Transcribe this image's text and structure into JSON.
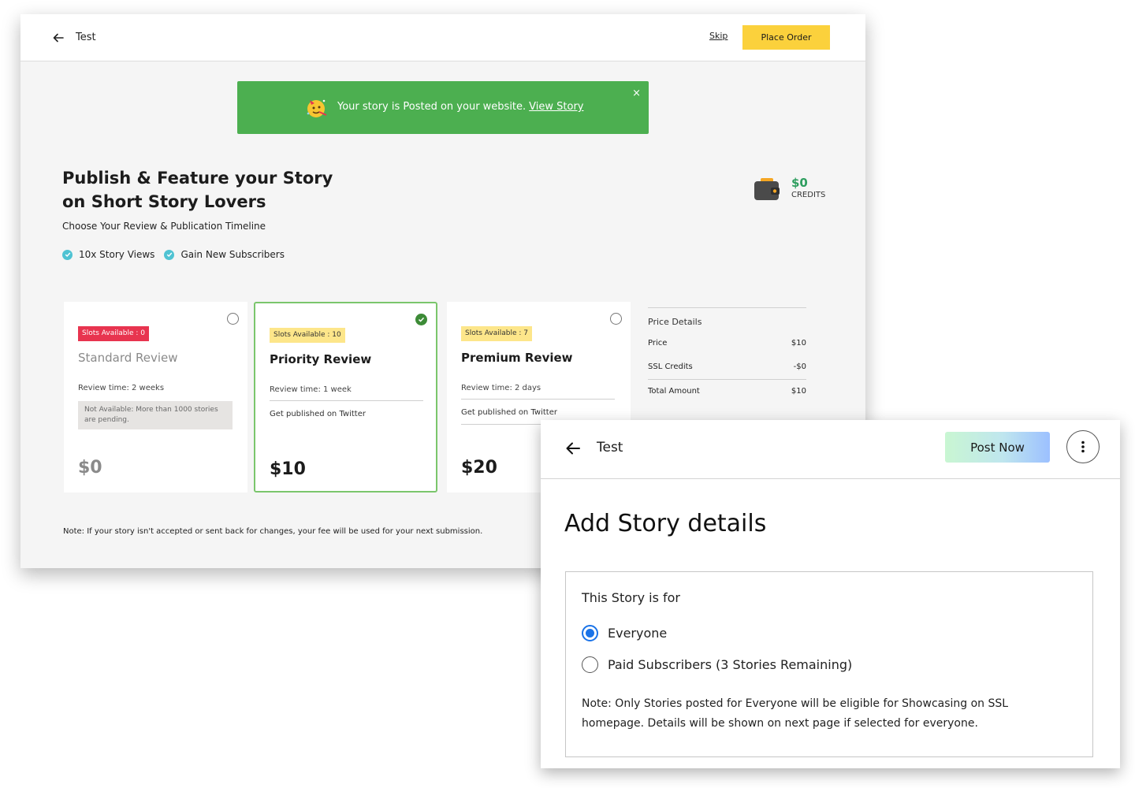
{
  "publish_window": {
    "header": {
      "title": "Test",
      "skip_label": "Skip",
      "place_order_label": "Place Order"
    },
    "toast": {
      "message": "Your story is Posted on your website.",
      "link_label": "View Story",
      "close_label": "×"
    },
    "headline": "Publish & Feature your Story on Short Story Lovers",
    "subheadline": "Choose Your Review & Publication Timeline",
    "benefits": [
      "10x Story Views",
      "Gain New Subscribers"
    ],
    "credits": {
      "amount": "$0",
      "label": "CREDITS"
    },
    "plans": [
      {
        "slots": "Slots Available : 0",
        "title": "Standard Review",
        "review_time": "Review time: 2 weeks",
        "unavailable_note": "Not Available: More than 1000 stories are pending.",
        "price": "$0",
        "selected": false
      },
      {
        "slots": "Slots Available : 10",
        "title": "Priority Review",
        "review_time": "Review time: 1 week",
        "publish_note": "Get published on Twitter",
        "price": "$10",
        "selected": true
      },
      {
        "slots": "Slots Available : 7",
        "title": "Premium Review",
        "review_time": "Review time: 2 days",
        "publish_note": "Get published on Twitter",
        "price": "$20",
        "selected": false
      }
    ],
    "price_details": {
      "title": "Price Details",
      "rows": [
        {
          "label": "Price",
          "value": "$10"
        },
        {
          "label": "SSL Credits",
          "value": "-$0"
        },
        {
          "label": "Total Amount",
          "value": "$10"
        }
      ]
    },
    "note": "Note: If your story isn't accepted or sent back for changes, your fee will be used for your next submission."
  },
  "story_window": {
    "header": {
      "title": "Test",
      "post_now_label": "Post Now"
    },
    "heading": "Add Story details",
    "audience": {
      "label": "This Story is for",
      "options": [
        {
          "label": "Everyone",
          "selected": true
        },
        {
          "label": "Paid Subscribers (3 Stories Remaining)",
          "selected": false
        }
      ]
    },
    "note": "Note: Only Stories posted for Everyone will be eligible for Showcasing on SSL homepage. Details will be shown on next page if selected for everyone."
  },
  "colors": {
    "accent_yellow": "#fbd13c",
    "toast_green": "#4caf50",
    "selected_border": "#7bc66c",
    "badge_red": "#e8344f",
    "badge_yellow": "#fde68a",
    "radio_blue": "#1a73e8",
    "credits_green": "#2e9e5f"
  },
  "icons": [
    "back-arrow-icon",
    "party-emoji-icon",
    "close-icon",
    "check-circle-icon",
    "wallet-icon",
    "radio-icon",
    "more-vertical-icon"
  ]
}
